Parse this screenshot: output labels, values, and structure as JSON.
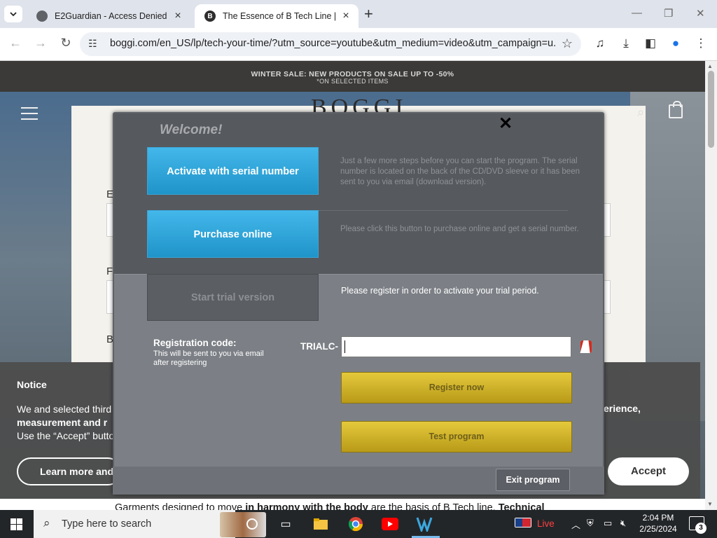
{
  "browser": {
    "tabs": [
      {
        "title": "E2Guardian - Access Denied",
        "active": false,
        "favicon_letter": "",
        "favicon_color": "#5f6368"
      },
      {
        "title": "The Essence of B Tech Line | Bo",
        "active": true,
        "favicon_letter": "B",
        "favicon_color": "#2d2d2d"
      }
    ],
    "new_tab_label": "+",
    "address_bar_url": "boggi.com/en_US/lp/tech-your-time/?utm_source=youtube&utm_medium=video&utm_campaign=u...",
    "icons": {
      "back": "back-arrow-icon",
      "forward": "forward-arrow-icon",
      "reload": "reload-icon",
      "site_info": "site-info-icon",
      "bookmark": "star-icon",
      "media": "media-control-icon",
      "download": "download-icon",
      "side_panel": "side-panel-icon",
      "profile": "profile-icon",
      "menu": "kebab-menu-icon"
    }
  },
  "page": {
    "sale_banner": {
      "main": "WINTER SALE: NEW PRODUCTS ON SALE UP TO -50%",
      "sub": "*ON SELECTED ITEMS"
    },
    "logo": "BOGGI",
    "form_labels": [
      "E",
      "F",
      "B"
    ],
    "cookie_notice": {
      "title": "Notice",
      "text_line1": "We and selected third",
      "text_line2_bold": "measurement and r",
      "text_line3": "Use the “Accept” butto",
      "text_right": "erience,",
      "learn_more_label": "Learn more and customize",
      "accept_label": "Accept"
    },
    "footer_text_pre": "Garments designed to move ",
    "footer_text_bold": "in harmony with the body",
    "footer_text_post": " are the basis of B Tech line. ",
    "footer_text_bold2": "Technical"
  },
  "dialog": {
    "welcome_title": "Welcome!",
    "activate_serial_label": "Activate with serial number",
    "activate_serial_desc": "Just a few more steps before you can start the program. The serial number is located on the back of the CD/DVD sleeve or it has been sent to you via email (download version).",
    "purchase_online_label": "Purchase online",
    "purchase_online_desc": "Please click this button to purchase online and get a serial number.",
    "trial_label": "Start trial version",
    "trial_desc": "Please register in order to activate your trial period.",
    "registration_code_label": "Registration code:",
    "registration_code_sub": "This will be sent to you via email after registering",
    "registration_prefix": "TRIALC-",
    "registration_value": "",
    "register_now_label": "Register now",
    "test_program_label": "Test program",
    "exit_label": "Exit program",
    "close_symbol": "✕"
  },
  "taskbar": {
    "search_placeholder": "Type here to search",
    "live_label": "Live",
    "time": "2:04 PM",
    "date": "2/25/2024",
    "notification_count": "3",
    "apps": [
      "cortana-icon",
      "task-view-icon",
      "file-explorer-icon",
      "chrome-icon",
      "youtube-icon",
      "activation-app-icon"
    ]
  },
  "colors": {
    "accent_blue": "#2ba3d9",
    "gold_button": "#d4b82c",
    "taskbar_bg": "#232629",
    "dialog_bg": "#56595e"
  }
}
